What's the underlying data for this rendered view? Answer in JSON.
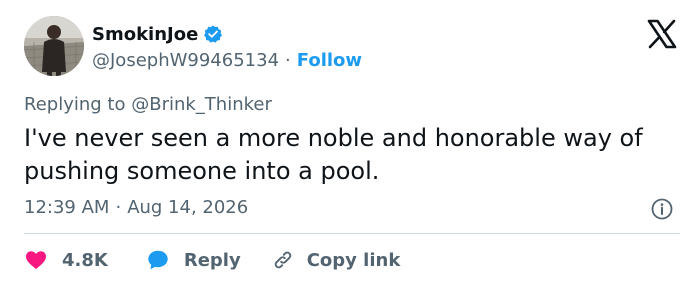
{
  "author": {
    "display_name": "SmokinJoe",
    "handle": "@JosephW99465134",
    "separator": "·",
    "follow_label": "Follow",
    "verified": true
  },
  "reply_context": {
    "prefix": "Replying to",
    "mention": "@Brink_Thinker"
  },
  "tweet": {
    "text": "I've never seen a more noble and honorable way of pushing someone into a pool.",
    "time": "12:39 AM",
    "separator": "·",
    "date": "Aug 14, 2026"
  },
  "actions": {
    "likes_count": "4.8K",
    "reply_label": "Reply",
    "copy_label": "Copy link"
  },
  "icons": {
    "verified": "verified-badge-icon",
    "logo": "x-logo-icon",
    "info": "info-icon",
    "like": "heart-icon",
    "reply": "speech-bubble-icon",
    "copy": "link-icon"
  },
  "colors": {
    "accent": "#1d9bf0",
    "like": "#f91880",
    "text": "#0f1419",
    "secondary": "#536471",
    "divider": "#cfd9de"
  }
}
